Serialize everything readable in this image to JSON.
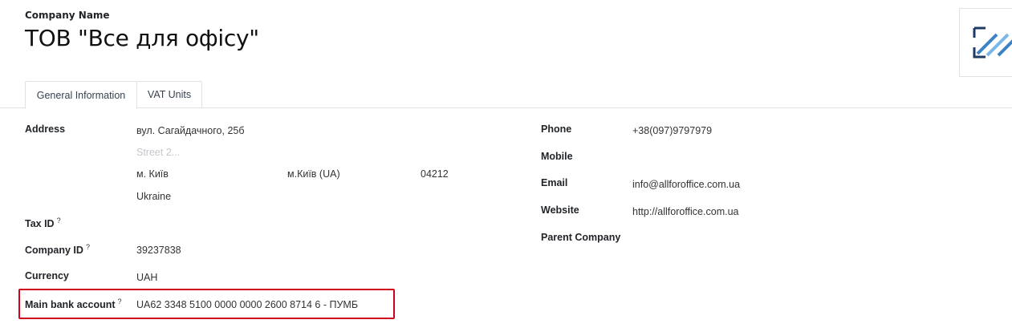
{
  "header": {
    "company_label": "Company Name",
    "company_name": "ТОВ \"Все для офісу\""
  },
  "tabs": [
    {
      "label": "General Information",
      "active": true
    },
    {
      "label": "VAT Units",
      "active": false
    }
  ],
  "left": {
    "address_label": "Address",
    "street": "вул. Сагайдачного, 25б",
    "street2_placeholder": "Street 2...",
    "city": "м. Київ",
    "state": "м.Київ (UA)",
    "zip": "04212",
    "country": "Ukraine",
    "tax_id_label": "Tax ID",
    "company_id_label": "Company ID",
    "company_id": "39237838",
    "currency_label": "Currency",
    "currency": "UAH",
    "bank_label": "Main bank account",
    "bank": "UA62 3348 5100 0000 0000 2600 8714 6 - ПУМБ",
    "help_mark": "?"
  },
  "right": {
    "phone_label": "Phone",
    "phone": "+38(097)9797979",
    "mobile_label": "Mobile",
    "email_label": "Email",
    "email": "info@allforoffice.com.ua",
    "website_label": "Website",
    "website": "http://allforoffice.com.ua",
    "parent_label": "Parent Company"
  },
  "colors": {
    "highlight": "#d0021b",
    "logo_blue": "#3b82c4",
    "logo_navy": "#1f3a66"
  },
  "icons": {
    "logo": "company-logo-placeholder-icon"
  }
}
